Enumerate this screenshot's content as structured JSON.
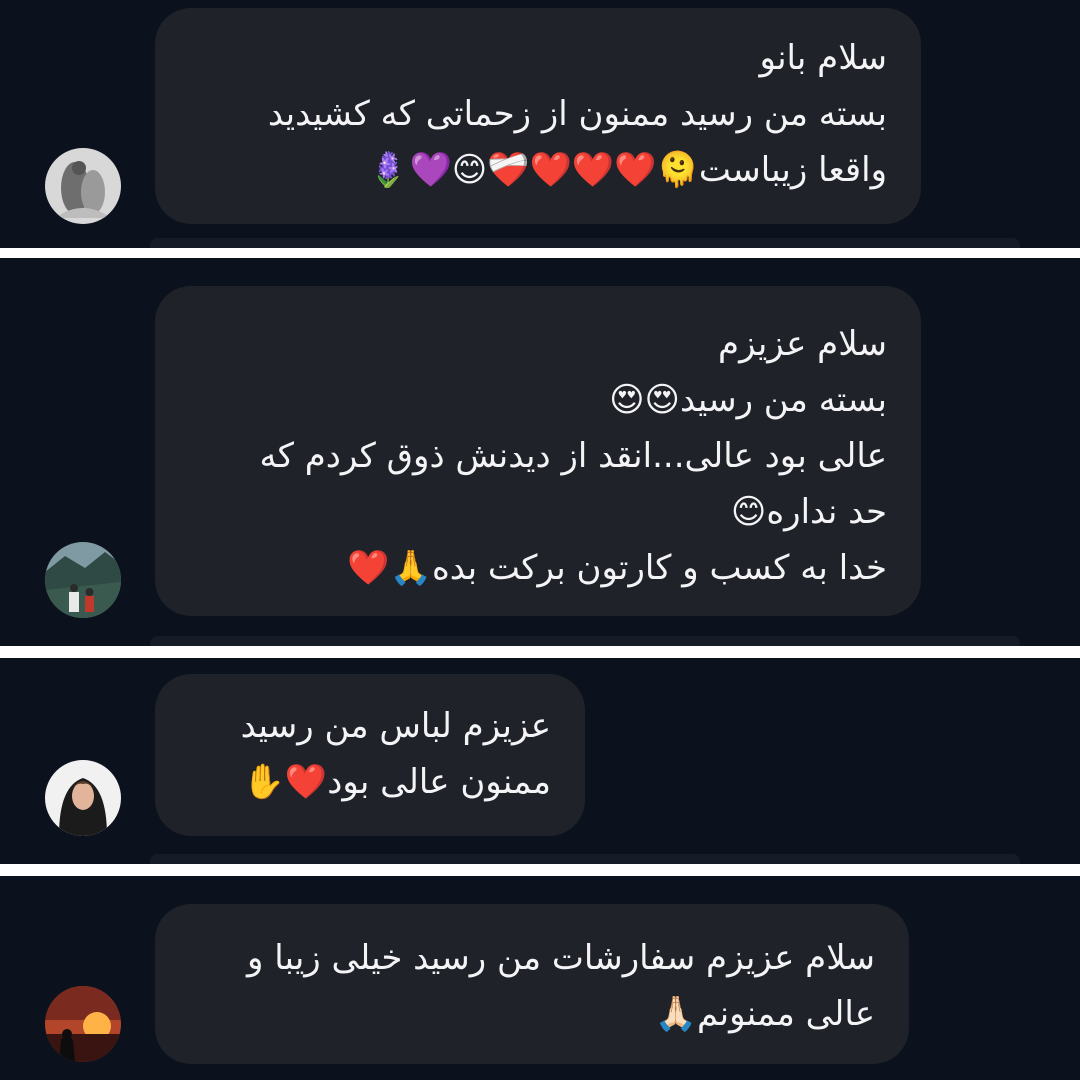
{
  "comments": [
    {
      "avatar": "avatar-photo-sculpture",
      "lines": [
        "سلام بانو",
        "بسته من رسید ممنون از زحماتی که کشیدید",
        "واقعا زیباست🫠❤️❤️❤️❤️‍🩹😊💜🪻"
      ]
    },
    {
      "avatar": "avatar-photo-couple-mountains",
      "lines": [
        "سلام عزیزم",
        "بسته من رسید😍😍",
        "عالی بود عالی...انقد از دیدنش ذوق کردم که",
        "حد نداره😊",
        "خدا به کسب و کارتون برکت بده🙏❤️"
      ]
    },
    {
      "avatar": "avatar-photo-woman",
      "lines": [
        "عزیزم لباس من رسید",
        "ممنون عالی بود❤️✋"
      ]
    },
    {
      "avatar": "avatar-photo-sunset-silhouette",
      "lines": [
        "سلام عزیزم سفارشات من رسید خیلی زیبا و",
        "عالی ممنونم🙏🏻"
      ]
    }
  ],
  "colors": {
    "panel_background": "#0c121d",
    "bubble_background": "#1f2228",
    "text": "#f4f4f6",
    "separator": "#ffffff"
  }
}
